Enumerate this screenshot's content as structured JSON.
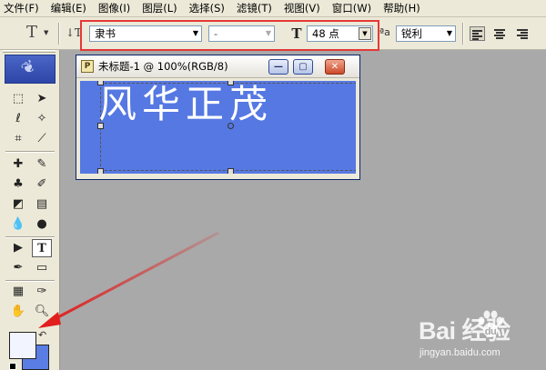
{
  "menu": [
    "文件(F)",
    "编辑(E)",
    "图像(I)",
    "图层(L)",
    "选择(S)",
    "滤镜(T)",
    "视图(V)",
    "窗口(W)",
    "帮助(H)"
  ],
  "options_bar": {
    "tool_preset_icon": "T",
    "orientation_icon": "text-orientation-icon",
    "font_family": "隶书",
    "font_style": "-",
    "size_icon": "T",
    "font_size": "48 点",
    "aa_icon": "ªa",
    "anti_alias": "锐利",
    "align_icons": [
      "align-left-icon",
      "align-center-icon",
      "align-right-icon"
    ]
  },
  "toolbox": {
    "tools": [
      "marquee-icon",
      "move-icon",
      "lasso-icon",
      "magic-wand-icon",
      "crop-icon",
      "slice-icon",
      "healing-brush-icon",
      "brush-icon",
      "stamp-icon",
      "history-brush-icon",
      "eraser-icon",
      "gradient-icon",
      "blur-icon",
      "dodge-icon",
      "path-select-icon",
      "type-icon",
      "pen-icon",
      "shape-icon",
      "notes-icon",
      "eyedropper-icon",
      "hand-icon",
      "zoom-icon"
    ],
    "foreground_color": "#f2f4ff",
    "background_color": "#5a7de4"
  },
  "document": {
    "icon": "document-icon",
    "title": "未标题-1 @ 100%(RGB/8)",
    "canvas_text": "风华正茂",
    "canvas_color": "#5678e2",
    "buttons": [
      "minimize-icon",
      "maximize-icon",
      "close-icon"
    ]
  },
  "annotation": {
    "highlight_color": "#e53838"
  },
  "watermark": {
    "brand": "Bai  经验",
    "url": "jingyan.baidu.com"
  }
}
